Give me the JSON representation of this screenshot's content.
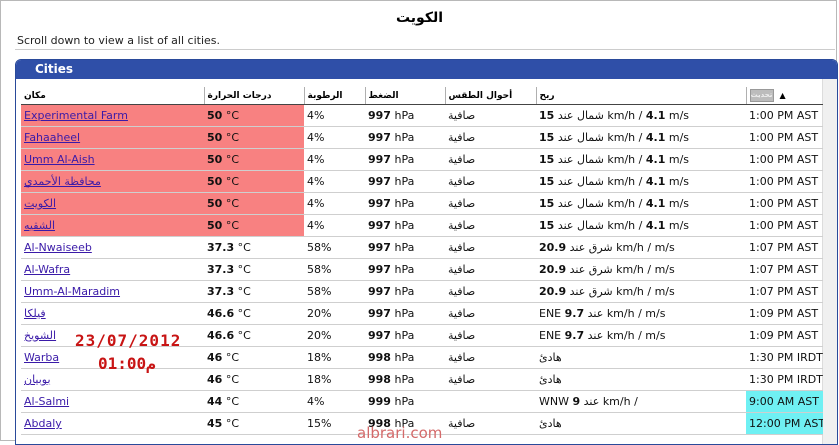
{
  "header": {
    "title": "الكويت",
    "hint": "Scroll down to view a list of all cities."
  },
  "panel": {
    "title": "Cities",
    "columns": {
      "place": "مكان",
      "temp": "درجات الحرارة",
      "humidity": "الرطوبة",
      "pressure": "الضغط",
      "conditions": "أحوال الطقس",
      "wind": "ريح",
      "updated": "تحديث"
    }
  },
  "rows": [
    {
      "city": "Experimental Farm",
      "temp": "50",
      "hum": "4%",
      "pres": "997",
      "cond": "صافية",
      "wind_val": "15",
      "wind_dir": "شمال عند",
      "wind_unit": "km/h /",
      "wind_ms": "4.1",
      "wind_ms_unit": "m/s",
      "time": "1:00 PM AST"
    },
    {
      "city": "Fahaaheel",
      "temp": "50",
      "hum": "4%",
      "pres": "997",
      "cond": "صافية",
      "wind_val": "15",
      "wind_dir": "شمال عند",
      "wind_unit": "km/h /",
      "wind_ms": "4.1",
      "wind_ms_unit": "m/s",
      "time": "1:00 PM AST"
    },
    {
      "city": "Umm Al-Aish",
      "temp": "50",
      "hum": "4%",
      "pres": "997",
      "cond": "صافية",
      "wind_val": "15",
      "wind_dir": "شمال عند",
      "wind_unit": "km/h /",
      "wind_ms": "4.1",
      "wind_ms_unit": "m/s",
      "time": "1:00 PM AST"
    },
    {
      "city": "محافظة الأحمدي",
      "temp": "50",
      "hum": "4%",
      "pres": "997",
      "cond": "صافية",
      "wind_val": "15",
      "wind_dir": "شمال عند",
      "wind_unit": "km/h /",
      "wind_ms": "4.1",
      "wind_ms_unit": "m/s",
      "time": "1:00 PM AST"
    },
    {
      "city": "الكويت",
      "temp": "50",
      "hum": "4%",
      "pres": "997",
      "cond": "صافية",
      "wind_val": "15",
      "wind_dir": "شمال عند",
      "wind_unit": "km/h /",
      "wind_ms": "4.1",
      "wind_ms_unit": "m/s",
      "time": "1:00 PM AST"
    },
    {
      "city": "الشقيه",
      "temp": "50",
      "hum": "4%",
      "pres": "997",
      "cond": "صافية",
      "wind_val": "15",
      "wind_dir": "شمال عند",
      "wind_unit": "km/h /",
      "wind_ms": "4.1",
      "wind_ms_unit": "m/s",
      "time": "1:00 PM AST"
    },
    {
      "city": "Al-Nwaiseeb",
      "temp": "37.3",
      "hum": "58%",
      "pres": "997",
      "cond": "صافية",
      "wind_val": "20.9",
      "wind_dir": "شرق عند",
      "wind_unit": "km/h /",
      "wind_ms": "",
      "wind_ms_unit": "m/s",
      "time": "1:07 PM AST"
    },
    {
      "city": "Al-Wafra",
      "temp": "37.3",
      "hum": "58%",
      "pres": "997",
      "cond": "صافية",
      "wind_val": "20.9",
      "wind_dir": "شرق عند",
      "wind_unit": "km/h /",
      "wind_ms": "",
      "wind_ms_unit": "m/s",
      "time": "1:07 PM AST"
    },
    {
      "city": "Umm-Al-Maradim",
      "temp": "37.3",
      "hum": "58%",
      "pres": "997",
      "cond": "صافية",
      "wind_val": "20.9",
      "wind_dir": "شرق عند",
      "wind_unit": "km/h /",
      "wind_ms": "",
      "wind_ms_unit": "m/s",
      "time": "1:07 PM AST"
    },
    {
      "city": "فيلكا",
      "temp": "46.6",
      "hum": "20%",
      "pres": "997",
      "cond": "صافية",
      "wind_pre": "ENE",
      "wind_val": "9.7",
      "wind_dir": "عند",
      "wind_unit": "km/h /",
      "wind_ms": "",
      "wind_ms_unit": "m/s",
      "time": "1:09 PM AST"
    },
    {
      "city": "الشويخ",
      "temp": "46.6",
      "hum": "20%",
      "pres": "997",
      "cond": "صافية",
      "wind_pre": "ENE",
      "wind_val": "9.7",
      "wind_dir": "عند",
      "wind_unit": "km/h /",
      "wind_ms": "",
      "wind_ms_unit": "m/s",
      "time": "1:09 PM AST"
    },
    {
      "city": "Warba",
      "temp": "46",
      "hum": "18%",
      "pres": "998",
      "cond": "صافية",
      "wind_text": "هادئ",
      "time": "1:30 PM IRDT"
    },
    {
      "city": "بوبيان",
      "temp": "46",
      "hum": "18%",
      "pres": "998",
      "cond": "صافية",
      "wind_text": "هادئ",
      "time": "1:30 PM IRDT"
    },
    {
      "city": "Al-Salmi",
      "temp": "44",
      "hum": "4%",
      "pres": "999",
      "cond": "",
      "wind_pre": "WNW",
      "wind_val": "9",
      "wind_dir": "عند",
      "wind_unit": "km/h /",
      "wind_ms": "",
      "wind_ms_unit": "",
      "time": "9:00 AM AST"
    },
    {
      "city": "Abdaly",
      "temp": "45",
      "hum": "15%",
      "pres": "998",
      "cond": "صافية",
      "wind_text": "هادئ",
      "time": "12:00 PM AST"
    }
  ],
  "units": {
    "temp": "°C",
    "pressure": "hPa"
  },
  "highlight_colors": {
    "hot": "#f88181",
    "updated": "#6ff0f3"
  },
  "overlay": {
    "date_stamp": "23/07/2012",
    "time_stamp": "01:00م",
    "watermark": "albrari.com"
  }
}
